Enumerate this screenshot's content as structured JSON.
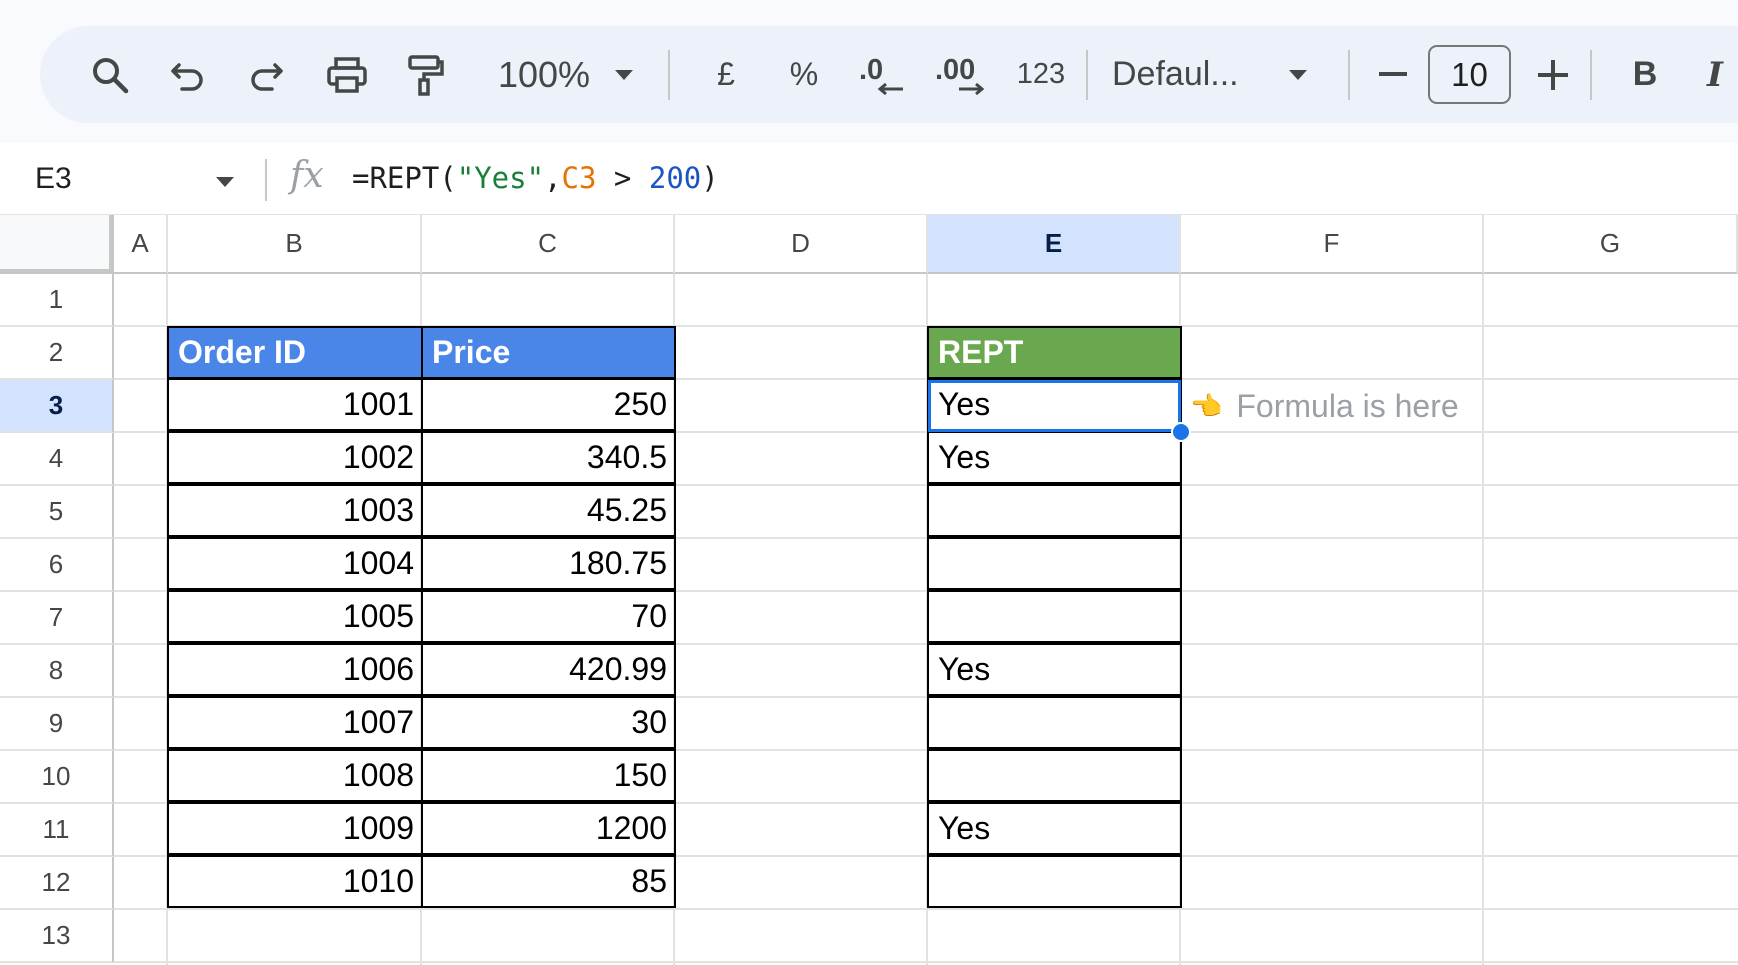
{
  "toolbar": {
    "zoom": "100%",
    "currency": "£",
    "percent": "%",
    "decrease_decimal": ".0",
    "increase_decimal": ".00",
    "number_format": "123",
    "font": "Defaul...",
    "font_size": "10",
    "bold": "B",
    "italic": "I"
  },
  "formula_bar": {
    "cell_ref": "E3",
    "fx": "fx",
    "formula_parts": {
      "p1": "=REPT(",
      "p2": "\"Yes\"",
      "p3": ",",
      "p4": "C3",
      "p5": " > ",
      "p6": "200",
      "p7": ")"
    }
  },
  "columns": [
    "A",
    "B",
    "C",
    "D",
    "E",
    "F",
    "G"
  ],
  "rows": [
    "1",
    "2",
    "3",
    "4",
    "5",
    "6",
    "7",
    "8",
    "9",
    "10",
    "11",
    "12",
    "13"
  ],
  "table": {
    "headers": {
      "order_id": "Order ID",
      "price": "Price",
      "rept": "REPT"
    },
    "rows": [
      {
        "order_id": "1001",
        "price": "250",
        "rept": "Yes"
      },
      {
        "order_id": "1002",
        "price": "340.5",
        "rept": "Yes"
      },
      {
        "order_id": "1003",
        "price": "45.25",
        "rept": ""
      },
      {
        "order_id": "1004",
        "price": "180.75",
        "rept": ""
      },
      {
        "order_id": "1005",
        "price": "70",
        "rept": ""
      },
      {
        "order_id": "1006",
        "price": "420.99",
        "rept": "Yes"
      },
      {
        "order_id": "1007",
        "price": "30",
        "rept": ""
      },
      {
        "order_id": "1008",
        "price": "150",
        "rept": ""
      },
      {
        "order_id": "1009",
        "price": "1200",
        "rept": "Yes"
      },
      {
        "order_id": "1010",
        "price": "85",
        "rept": ""
      }
    ]
  },
  "annotation": {
    "pointer": "👈",
    "text": "Formula is here"
  },
  "colors": {
    "header_blue": "#4a86e8",
    "header_green": "#6aa84f",
    "selection": "#1a73e8",
    "toolbar_bg": "#edf2fa"
  }
}
